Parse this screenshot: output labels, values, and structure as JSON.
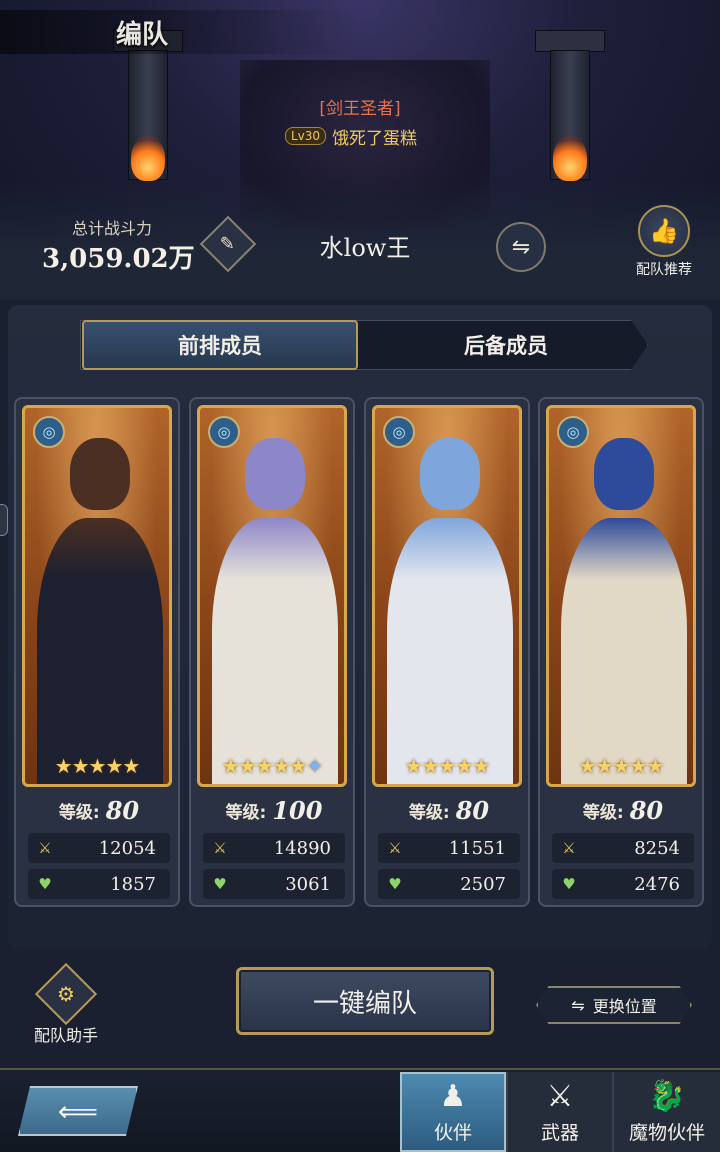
{
  "header": {
    "title": "编队"
  },
  "player": {
    "title": "[剑王圣者]",
    "level": "Lv30",
    "name": "饿死了蛋糕"
  },
  "team": {
    "power_label": "总计战斗力",
    "power_value": "3,059.02万",
    "name": "水low王",
    "recommend_label": "配队推荐"
  },
  "tabs": {
    "front": "前排成员",
    "reserve": "后备成员"
  },
  "members": [
    {
      "level_label": "等级:",
      "level": "80",
      "attack": "12054",
      "hp": "1857",
      "stars": "★★★★★",
      "extra_star": "",
      "hair": "#4a2f22",
      "outfit": "#1c2030"
    },
    {
      "level_label": "等级:",
      "level": "100",
      "attack": "14890",
      "hp": "3061",
      "stars": "★★★★★",
      "extra_star": "✦",
      "hair": "#8d86c8",
      "outfit": "#e6e2da"
    },
    {
      "level_label": "等级:",
      "level": "80",
      "attack": "11551",
      "hp": "2507",
      "stars": "★★★★★",
      "extra_star": "",
      "hair": "#7fa6dc",
      "outfit": "#e4e6ee"
    },
    {
      "level_label": "等级:",
      "level": "80",
      "attack": "8254",
      "hp": "2476",
      "stars": "★★★★★",
      "extra_star": "",
      "hair": "#2e4a9a",
      "outfit": "#e2d8c6"
    }
  ],
  "actions": {
    "helper": "配队助手",
    "auto_formation": "一键编队",
    "swap_position": "更换位置"
  },
  "nav": {
    "partner": "伙伴",
    "weapon": "武器",
    "monster": "魔物伙伴"
  },
  "icons": {
    "edit": "feather-icon",
    "swap": "swap-arrows-icon",
    "recommend": "thumbs-up-icon",
    "element": "water-swirl-icon",
    "attack": "crossed-swords-icon",
    "hp": "heart-icon",
    "helper": "gear-wing-icon",
    "back": "back-arrow-icon",
    "partner": "partner-silhouette-icon",
    "weapon": "crossed-swords-icon",
    "monster": "dragon-icon"
  },
  "colors": {
    "accent_gold": "#b89a58",
    "active_tab": "#38506e",
    "card_frame": "#d7a84a",
    "title_red": "#e9724a",
    "name_gold": "#f0cc5e"
  }
}
